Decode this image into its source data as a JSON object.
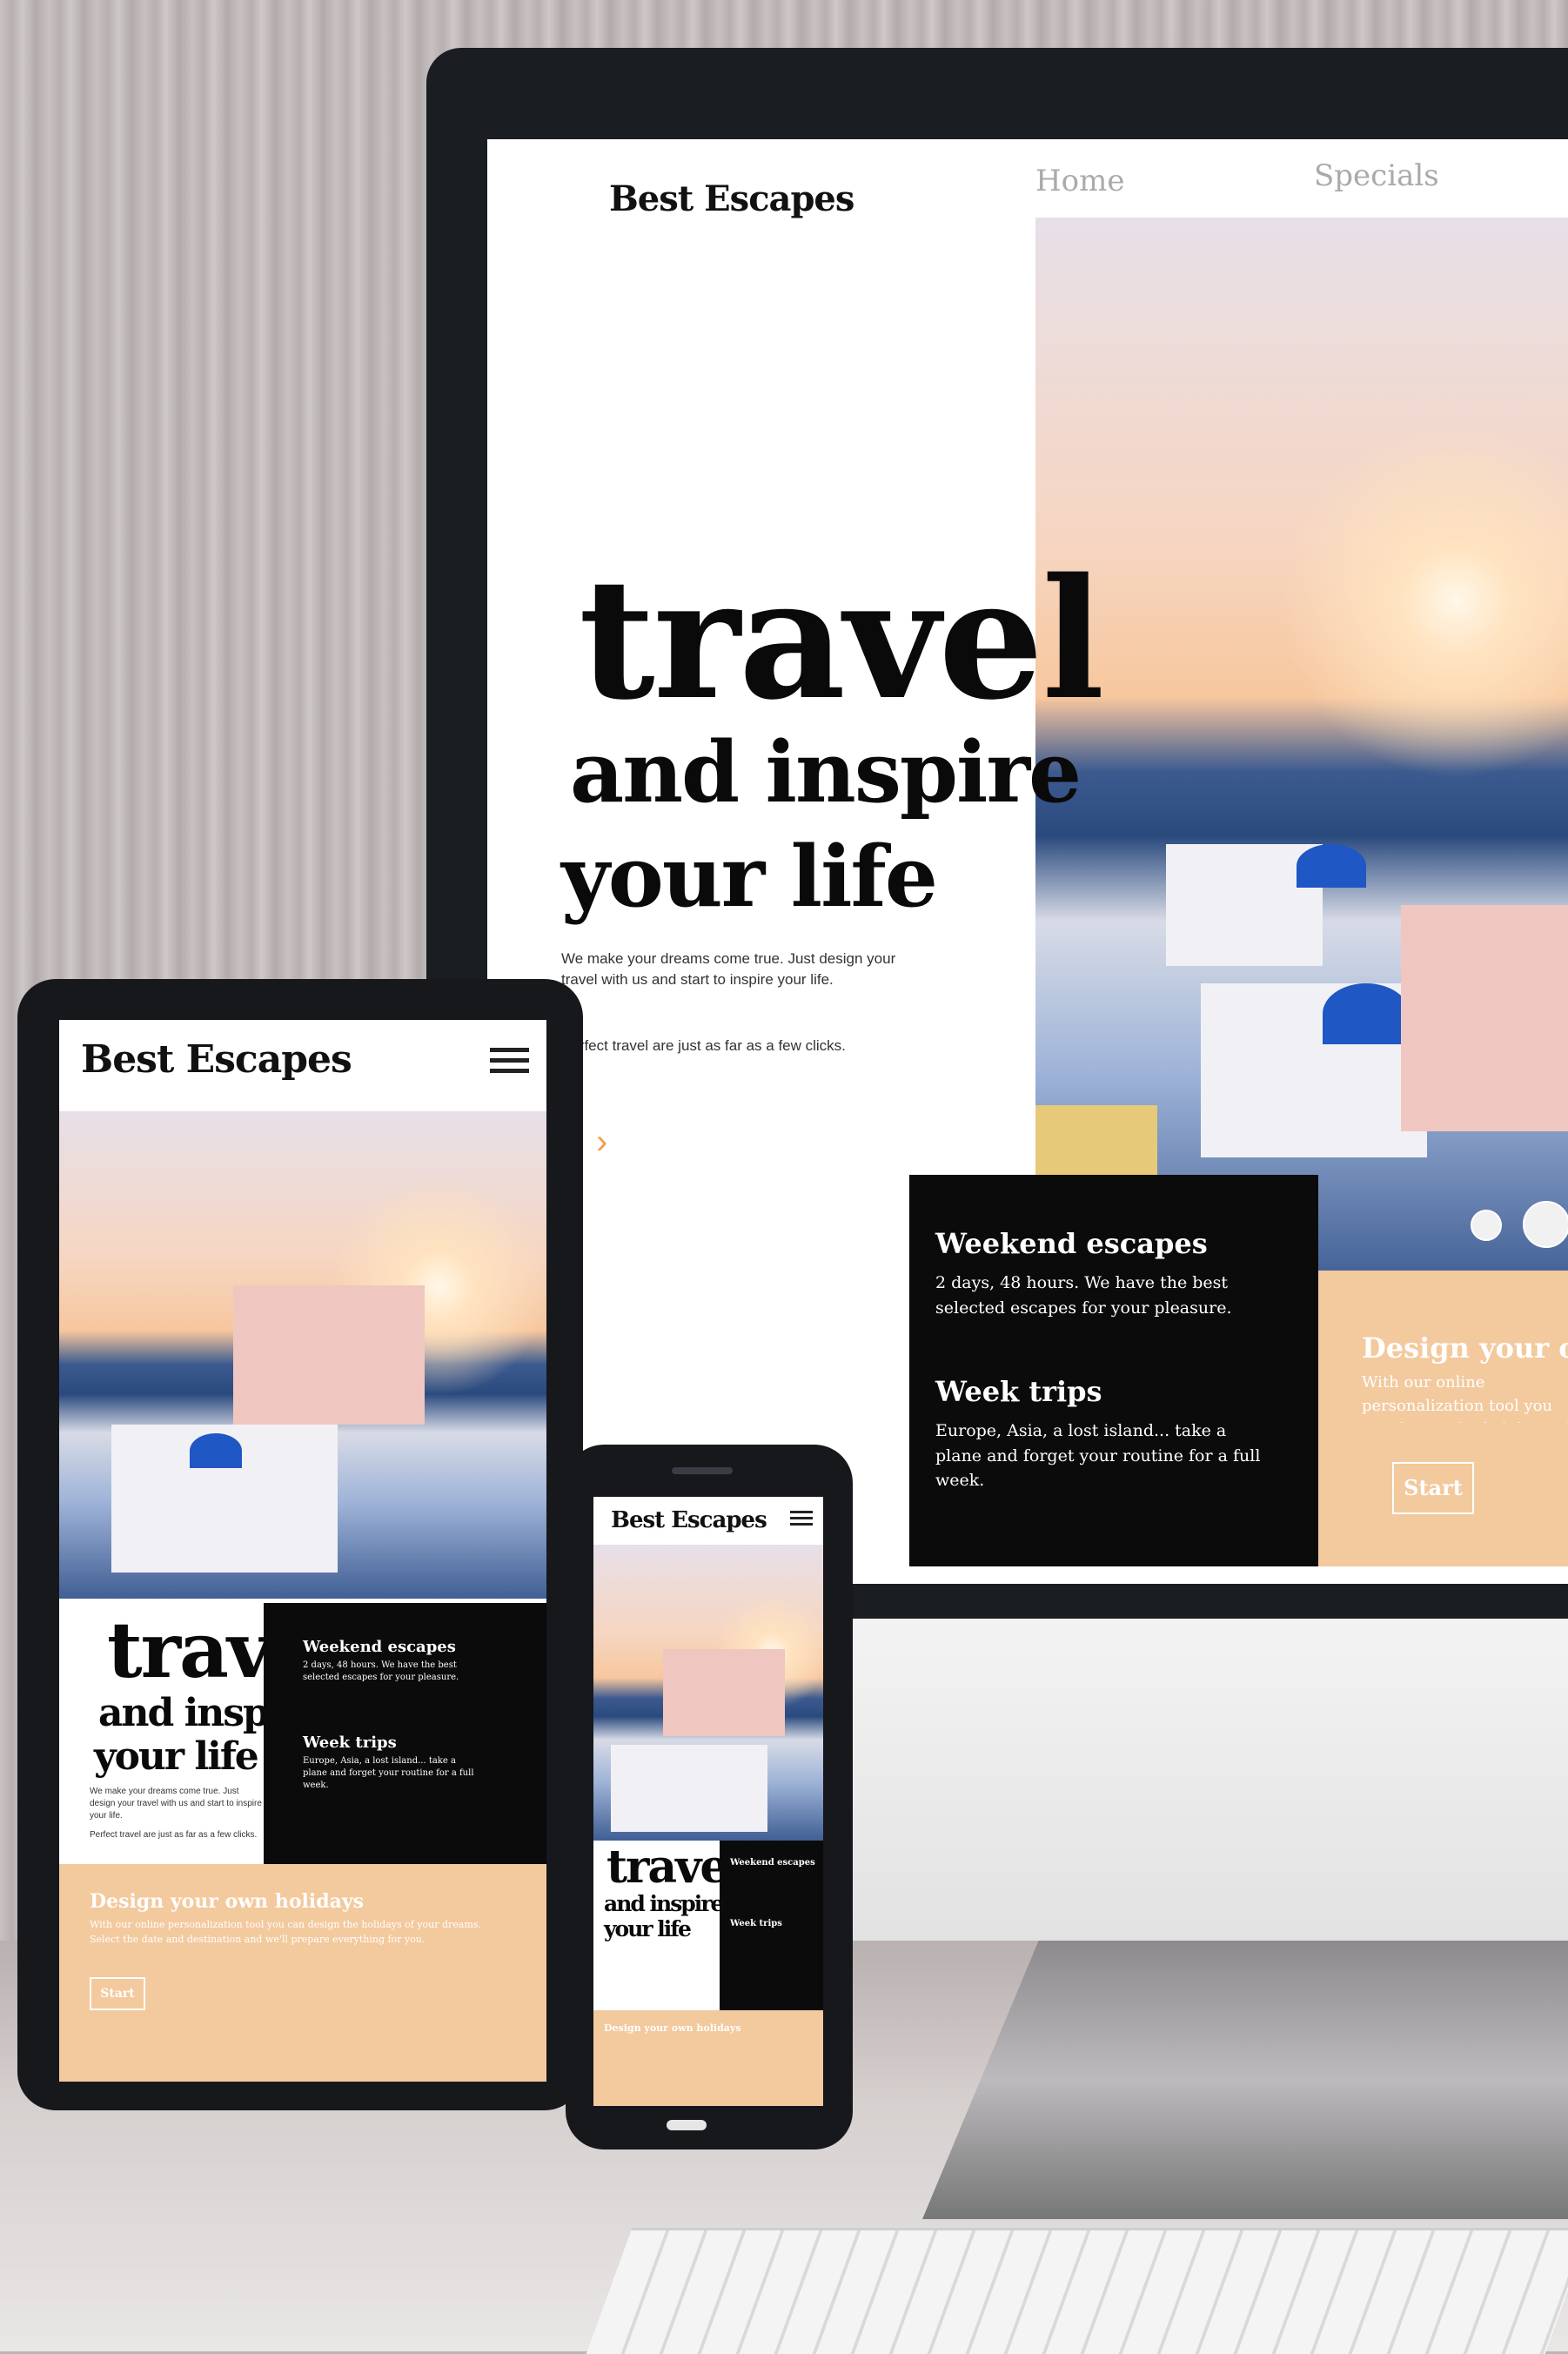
{
  "brand": "Best Escapes",
  "nav": {
    "home": "Home",
    "specials": "Specials"
  },
  "hero": {
    "big": "travel",
    "line1": "and inspire",
    "line2": "your life",
    "body1": "We make your dreams come true. Just design your travel with us and start to inspire your life.",
    "body2": "Perfect travel are just as far as a few clicks."
  },
  "cards": {
    "weekend_title": "Weekend escapes",
    "weekend_text": "2 days, 48 hours. We have the best selected escapes for your pleasure.",
    "week_title": "Week trips",
    "week_text": "Europe, Asia, a lost island... take a plane and forget your routine for a full week."
  },
  "promo": {
    "title": "Design your own holidays",
    "title_short": "Design your ow",
    "text": "With our online personalization tool you can design the holidays of your dreams. Select the date and destination and we'll prepare everything for you.",
    "start": "Start"
  },
  "colors": {
    "peach": "#f3c99e",
    "black": "#0b0b0b",
    "accent": "#f0a050"
  }
}
